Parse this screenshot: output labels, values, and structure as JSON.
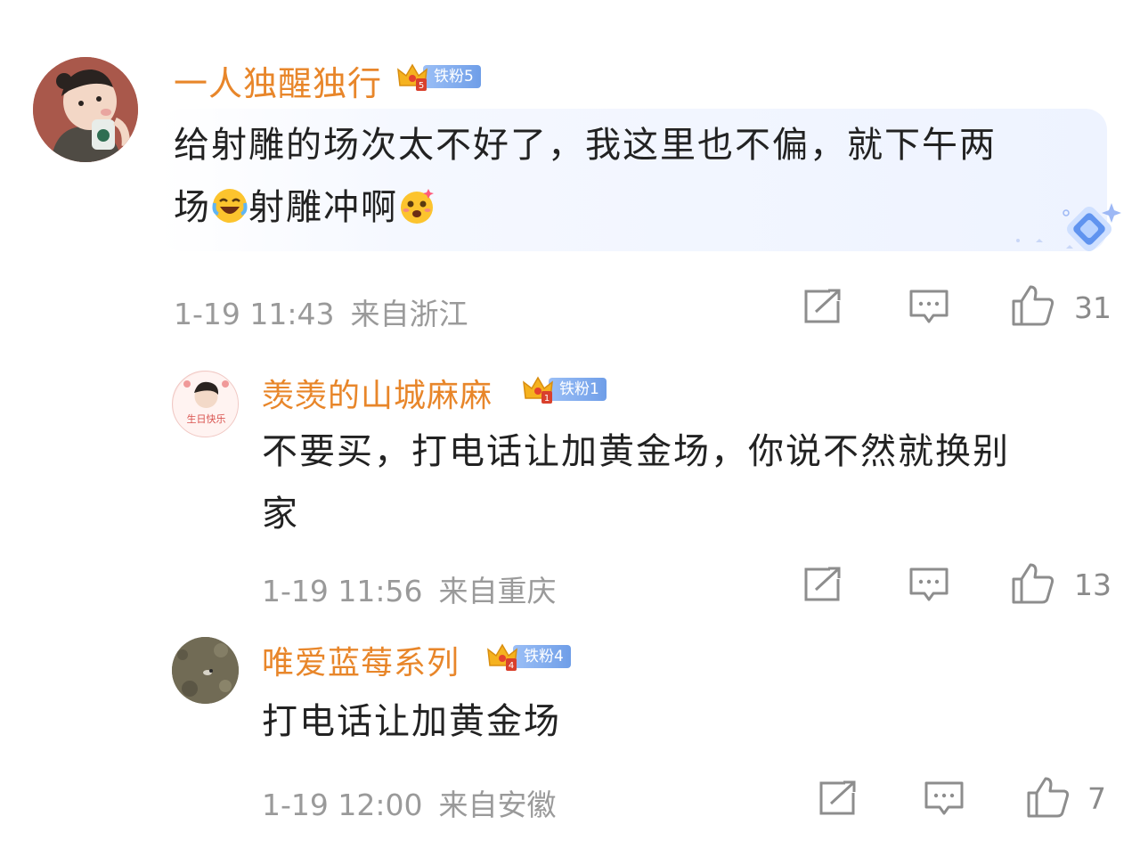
{
  "comments": [
    {
      "name": "一人独醒独行",
      "badge_label": "铁粉5",
      "badge_level": "5",
      "text_line1": "给射雕的场次太不好了，我这里也不偏，就下午两",
      "text_line2_a": "场",
      "text_line2_b": "射雕冲啊",
      "time": "1-19 11:43",
      "location": "来自浙江",
      "likes": "31"
    },
    {
      "name": "羡羡的山城麻麻",
      "badge_label": "铁粉1",
      "badge_level": "1",
      "avatar_text": "生日快乐",
      "text_line1": "不要买，打电话让加黄金场，你说不然就换别",
      "text_line2": "家",
      "time": "1-19 11:56",
      "location": "来自重庆",
      "likes": "13"
    },
    {
      "name": "唯爱蓝莓系列",
      "badge_label": "铁粉4",
      "badge_level": "4",
      "text_line1": "打电话让加黄金场",
      "time": "1-19 12:00",
      "location": "来自安徽",
      "likes": "7"
    }
  ],
  "icons": {
    "share": "share-icon",
    "comment": "comment-icon",
    "like": "thumbs-up-icon",
    "emoji_laugh": "laugh-cry-emoji",
    "emoji_excited": "excited-emoji",
    "crown": "crown-icon",
    "diamond": "diamond-sparkle-icon"
  },
  "colors": {
    "name": "#e8862a",
    "badge": "#7fa8ee",
    "meta": "#9a9a9a",
    "text": "#222222"
  }
}
